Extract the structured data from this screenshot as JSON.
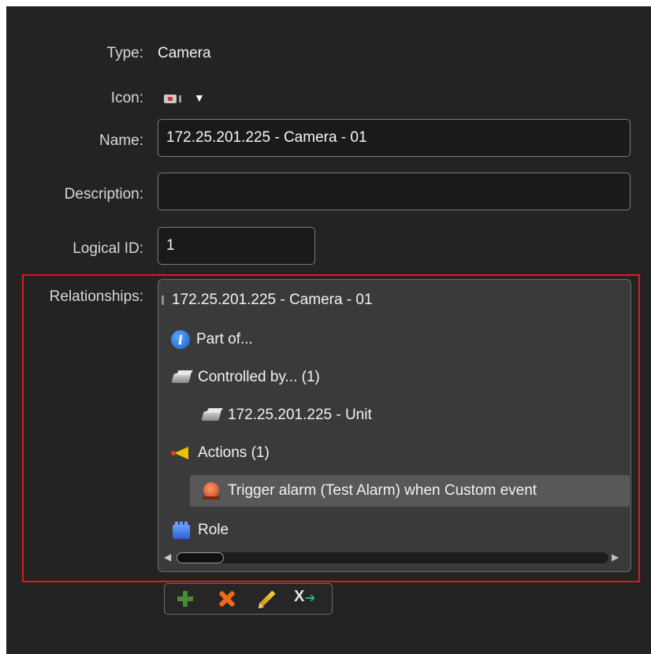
{
  "properties": {
    "type_label": "Type:",
    "type_value": "Camera",
    "icon_label": "Icon:",
    "icon_name": "camera-icon",
    "name_label": "Name:",
    "name_value": "172.25.201.225 - Camera - 01",
    "description_label": "Description:",
    "description_value": "",
    "logical_id_label": "Logical ID:",
    "logical_id_value": "1"
  },
  "relationships": {
    "label": "Relationships:",
    "items": [
      {
        "label": "172.25.201.225 - Camera - 01",
        "icon": "expand-arrow-icon"
      },
      {
        "label": "Part of...",
        "icon": "info-icon"
      },
      {
        "label": "Controlled by... (1)",
        "icon": "unit-icon"
      },
      {
        "label": "172.25.201.225 - Unit",
        "icon": "unit-icon"
      },
      {
        "label": "Actions (1)",
        "icon": "action-icon"
      },
      {
        "label": "Trigger alarm (Test Alarm) when Custom event",
        "icon": "alarm-icon",
        "selected": true
      },
      {
        "label": "Role",
        "icon": "role-icon"
      }
    ]
  },
  "toolbar": {
    "buttons": [
      "add-icon",
      "delete-icon",
      "edit-icon",
      "jump-to-icon"
    ]
  },
  "colors": {
    "background": "#232323",
    "highlight_border": "#e01919",
    "selected_row": "#585858"
  }
}
